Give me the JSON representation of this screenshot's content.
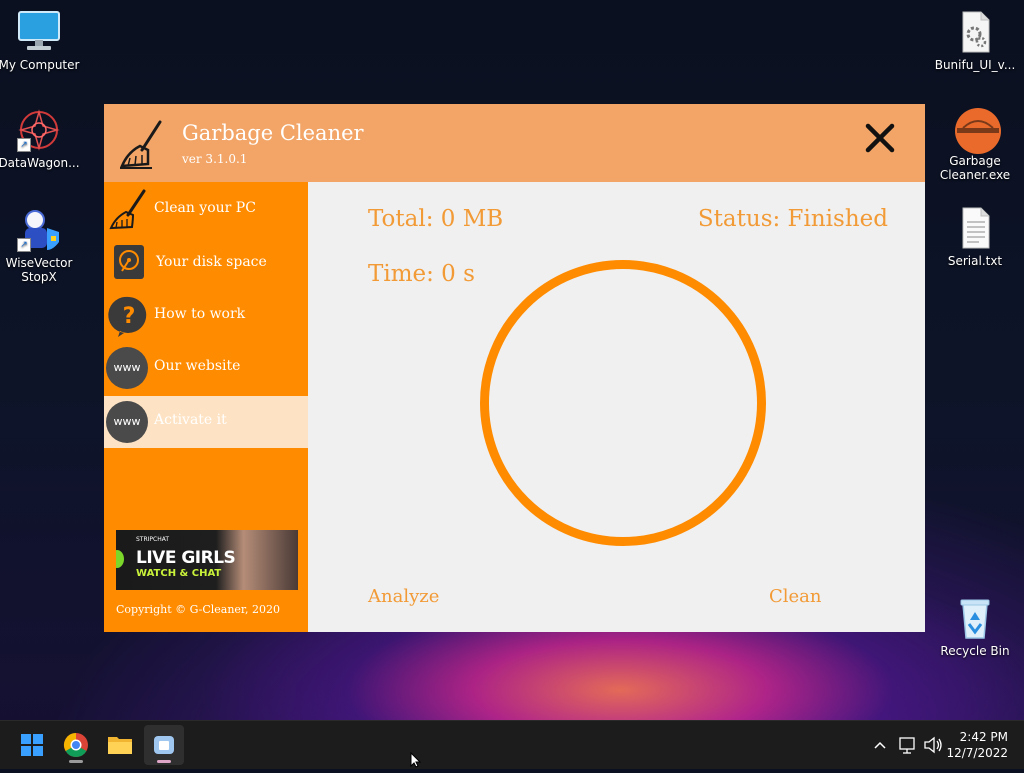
{
  "desktop": {
    "icons_left": [
      {
        "label": "My Computer"
      },
      {
        "label": "DataWagon..."
      },
      {
        "label": "WiseVector StopX"
      }
    ],
    "icons_right": [
      {
        "label": "Bunifu_UI_v..."
      },
      {
        "label": "Garbage Cleaner.exe"
      },
      {
        "label": "Serial.txt"
      },
      {
        "label": "Recycle Bin"
      }
    ]
  },
  "app": {
    "title": "Garbage Cleaner",
    "version": "ver 3.1.0.1",
    "sidebar": {
      "items": [
        {
          "label": "Clean your PC",
          "icon": "broom-icon"
        },
        {
          "label": "Your disk space",
          "icon": "disk-icon"
        },
        {
          "label": "How to work",
          "icon": "question-icon"
        },
        {
          "label": "Our website",
          "icon": "www-icon",
          "icon_text": "www"
        },
        {
          "label": "Activate it",
          "icon": "www-icon",
          "icon_text": "www",
          "active": true
        }
      ],
      "ad": {
        "brand": "STRIPCHAT",
        "line1": "LIVE GIRLS",
        "line2": "WATCH & CHAT"
      },
      "copyright": "Copyright © G-Cleaner, 2020"
    },
    "main": {
      "total": "Total: 0 MB",
      "status": "Status: Finished",
      "time": "Time: 0 s",
      "analyze_label": "Analyze",
      "clean_label": "Clean"
    },
    "colors": {
      "titlebar": "#f2a566",
      "sidebar": "#ff8b00",
      "accent_text": "#f29a35",
      "ring": "#ff8b00"
    }
  },
  "taskbar": {
    "time": "2:42 PM",
    "date": "12/7/2022"
  }
}
